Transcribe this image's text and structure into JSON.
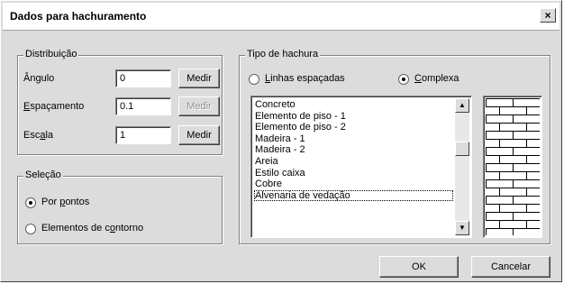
{
  "dialog": {
    "title": "Dados para hachuramento",
    "close_label": "×"
  },
  "distribuicao": {
    "legend": "Distribuição",
    "rows": [
      {
        "label": "Ângulo",
        "value": "0",
        "button": "Medir",
        "button_enabled": true
      },
      {
        "label": "Espaçamento",
        "value": "0.1",
        "button": "Medir",
        "button_enabled": false
      },
      {
        "label": "Escala",
        "value": "1",
        "button": "Medir",
        "button_enabled": true
      }
    ]
  },
  "selecao": {
    "legend": "Seleção",
    "options": [
      {
        "label": "Por pontos",
        "selected": true
      },
      {
        "label": "Elementos de contorno",
        "selected": false
      }
    ]
  },
  "tipo": {
    "legend": "Tipo de hachura",
    "options": [
      {
        "label": "Linhas espaçadas",
        "selected": false
      },
      {
        "label": "Complexa",
        "selected": true
      }
    ],
    "list": [
      "Concreto",
      "Elemento de piso - 1",
      "Elemento de piso - 2",
      "Madeira - 1",
      "Madeira - 2",
      "Areia",
      "Estilo caixa",
      "Cobre",
      "Alvenaria de vedação"
    ],
    "selected_item": "Alvenaria de vedação",
    "preview_icon": "brick-pattern-icon"
  },
  "buttons": {
    "ok": "OK",
    "cancel": "Cancelar"
  }
}
